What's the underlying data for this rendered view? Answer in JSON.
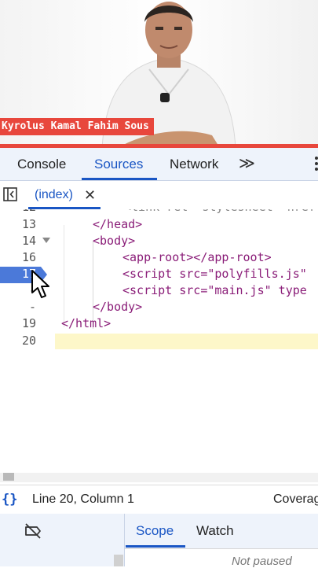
{
  "video": {
    "presenter_name": "Kyrolus Kamal Fahim Sous",
    "accent_color": "#e8473c"
  },
  "devtools": {
    "tabs": [
      {
        "label": "Console",
        "active": false
      },
      {
        "label": "Sources",
        "active": true
      },
      {
        "label": "Network",
        "active": false
      }
    ],
    "more_tabs_icon": "chevron-double-right-icon",
    "menu_icon": "kebab-menu-icon",
    "file_tab": {
      "label": "(index)",
      "close_icon": "close-icon"
    },
    "panel_toggle_icon": "sidebar-toggle-icon"
  },
  "editor": {
    "lines": [
      {
        "num": "13",
        "text": "</head>"
      },
      {
        "num": "14",
        "text": "<body>"
      },
      {
        "num": "16",
        "text": "<app-root></app-root>"
      },
      {
        "num": "17",
        "text": "<script src=\"polyfills.js\""
      },
      {
        "num": "-",
        "text": "<script src=\"main.js\" type"
      },
      {
        "num": "-",
        "text": "</body>"
      },
      {
        "num": "19",
        "text": "</html>"
      },
      {
        "num": "20",
        "text": ""
      }
    ],
    "breakpoint_line": "17",
    "highlighted_line": "20"
  },
  "status": {
    "format_icon": "{}",
    "position": "Line 20, Column 1",
    "coverage": "Coverag"
  },
  "debugger": {
    "deactivate_breakpoints_icon": "breakpoint-off-icon",
    "tabs": [
      {
        "label": "Scope",
        "active": true
      },
      {
        "label": "Watch",
        "active": false
      }
    ],
    "state_text": "Not paused"
  }
}
